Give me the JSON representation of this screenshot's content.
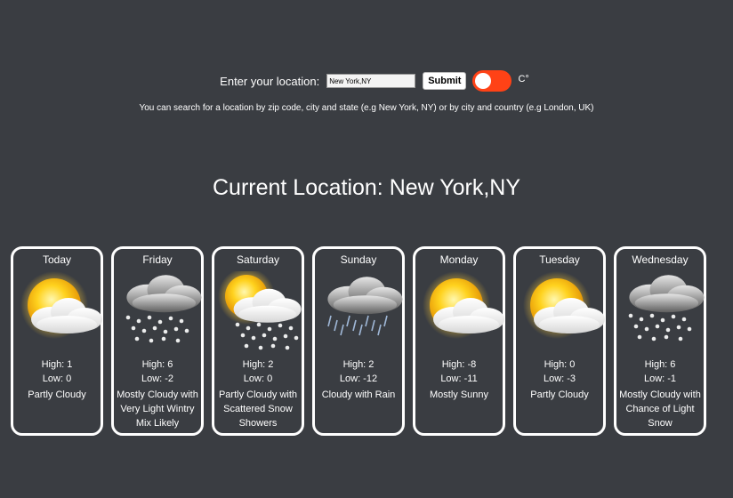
{
  "search": {
    "label": "Enter your location:",
    "value": "New York,NY",
    "submit_label": "Submit",
    "unit_label": "C°",
    "toggle_on": true,
    "hint": "You can search for a location by zip code, city and state (e.g New York, NY) or by city and country (e.g London, UK)"
  },
  "current_location": "Current Location: New York,NY",
  "colors": {
    "background": "#3a3d42",
    "toggle": "#ff4216",
    "text": "#ffffff"
  },
  "forecast": [
    {
      "day": "Today",
      "high": "High: 1",
      "low": "Low: 0",
      "condition": "Partly Cloudy",
      "icon": "partly-cloudy-icon"
    },
    {
      "day": "Friday",
      "high": "High: 6",
      "low": "Low: -2",
      "condition": "Mostly Cloudy with Very Light Wintry Mix Likely",
      "icon": "cloud-wintry-mix-icon"
    },
    {
      "day": "Saturday",
      "high": "High: 2",
      "low": "Low: 0",
      "condition": "Partly Cloudy with Scattered Snow Showers",
      "icon": "sun-cloud-snow-icon"
    },
    {
      "day": "Sunday",
      "high": "High: 2",
      "low": "Low: -12",
      "condition": "Cloudy with Rain",
      "icon": "cloud-rain-icon"
    },
    {
      "day": "Monday",
      "high": "High: -8",
      "low": "Low: -11",
      "condition": "Mostly Sunny",
      "icon": "partly-cloudy-icon"
    },
    {
      "day": "Tuesday",
      "high": "High: 0",
      "low": "Low: -3",
      "condition": "Partly Cloudy",
      "icon": "partly-cloudy-icon"
    },
    {
      "day": "Wednesday",
      "high": "High: 6",
      "low": "Low: -1",
      "condition": "Mostly Cloudy with Chance of Light Snow",
      "icon": "cloud-snow-icon"
    }
  ]
}
